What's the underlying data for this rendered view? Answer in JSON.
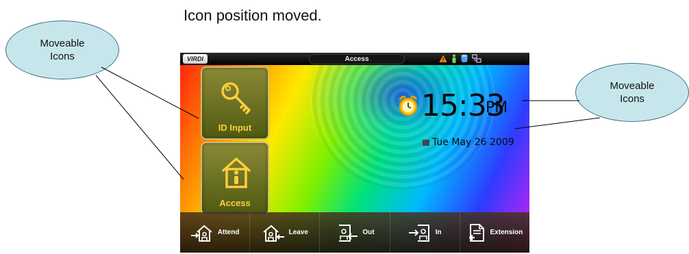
{
  "caption": "Icon position moved.",
  "callouts": {
    "left": "Moveable\nIcons",
    "right": "Moveable\nIcons"
  },
  "device": {
    "logo": "VIRDI",
    "title": "Access",
    "status_icons": [
      "warning-icon",
      "person-icon",
      "database-icon",
      "network-icon"
    ],
    "buttons": [
      {
        "label": "ID Input",
        "icon": "key-icon"
      },
      {
        "label": "Access",
        "icon": "house-person-icon"
      }
    ],
    "clock": {
      "time": "15:33",
      "ampm": "PM",
      "date": "Tue May 26 2009",
      "icon": "alarm-clock-icon"
    },
    "bottom_bar": [
      {
        "label": "Attend",
        "icon": "attend-icon"
      },
      {
        "label": "Leave",
        "icon": "leave-icon"
      },
      {
        "label": "Out",
        "icon": "out-icon"
      },
      {
        "label": "In",
        "icon": "in-icon"
      },
      {
        "label": "Extension",
        "icon": "extension-icon"
      }
    ]
  }
}
